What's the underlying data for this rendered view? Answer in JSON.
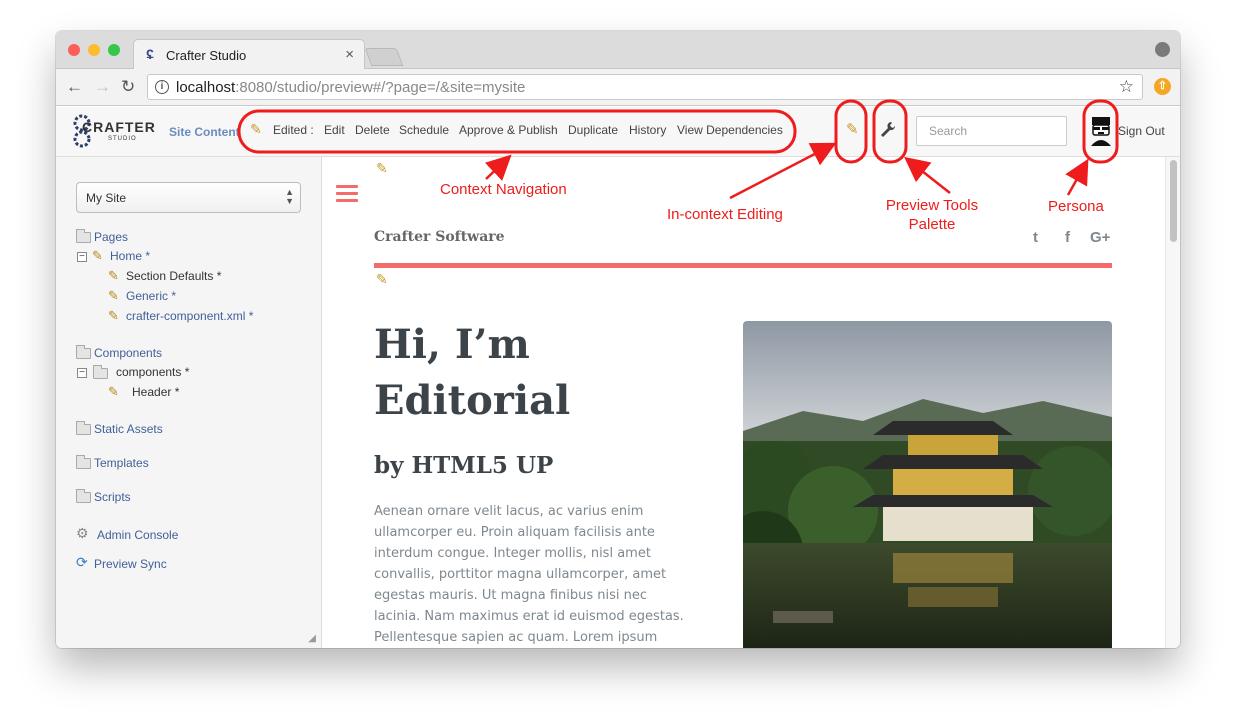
{
  "browser": {
    "tab_title": "Crafter Studio",
    "tab_close": "×",
    "url_host": "localhost",
    "url_rest": ":8080/studio/preview#/?page=/&site=mysite"
  },
  "header": {
    "logo_text": "CRAFTER",
    "logo_sub": "STUDIO",
    "site_content_label": "Site Content",
    "context_nav": {
      "edited": "Edited :",
      "edit": "Edit",
      "delete": "Delete",
      "schedule": "Schedule",
      "approve_publish": "Approve & Publish",
      "duplicate": "Duplicate",
      "history": "History",
      "view_dependencies": "View Dependencies"
    },
    "search_placeholder": "Search",
    "sign_out": "Sign Out"
  },
  "sidebar": {
    "site_select": "My Site",
    "pages": "Pages",
    "home": "Home *",
    "section_defaults": "Section Defaults *",
    "generic": "Generic *",
    "crafter_component": "crafter-component.xml *",
    "components": "Components",
    "components_child": "components *",
    "header_item": "Header *",
    "static_assets": "Static Assets",
    "templates": "Templates",
    "scripts": "Scripts",
    "admin_console": "Admin Console",
    "preview_sync": "Preview Sync"
  },
  "preview": {
    "brand": "Crafter Software",
    "hero_title": "Hi, I’m Editorial",
    "hero_subtitle": "by HTML5 UP",
    "hero_body": "Aenean ornare velit lacus, ac varius enim ullamcorper eu. Proin aliquam facilisis ante interdum congue. Integer mollis, nisl amet convallis, porttitor magna ullamcorper, amet egestas mauris. Ut magna finibus nisi nec lacinia. Nam maximus erat id euismod egestas. Pellentesque sapien ac quam. Lorem ipsum dolor",
    "social": {
      "twitter": "t",
      "facebook": "f",
      "google_plus": "G+"
    }
  },
  "annotations": {
    "context_navigation": "Context Navigation",
    "in_context_editing": "In-context Editing",
    "preview_tools_line1": "Preview Tools",
    "preview_tools_line2": "Palette",
    "persona": "Persona"
  },
  "colors": {
    "annotation_red": "#ee1c1c",
    "accent": "#f56a6a",
    "link_blue": "#41609a"
  }
}
